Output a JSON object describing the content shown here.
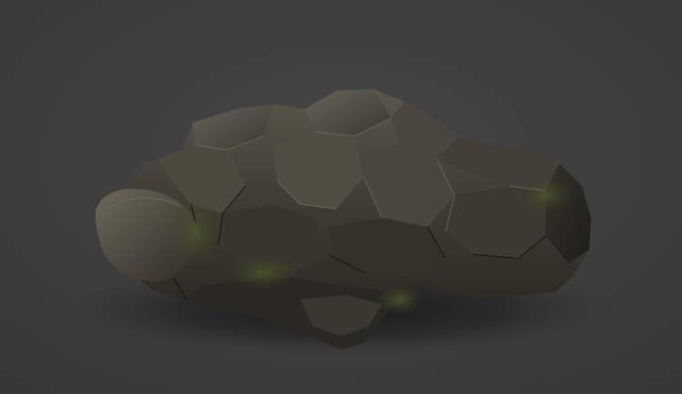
{
  "scene": {
    "subject": "rock-model",
    "background_color": "#404040",
    "surface_colors": {
      "base": "#3d3a33",
      "highlight": "#6b655a",
      "shadow": "#1e1c18",
      "moss": "#4a5230"
    }
  }
}
